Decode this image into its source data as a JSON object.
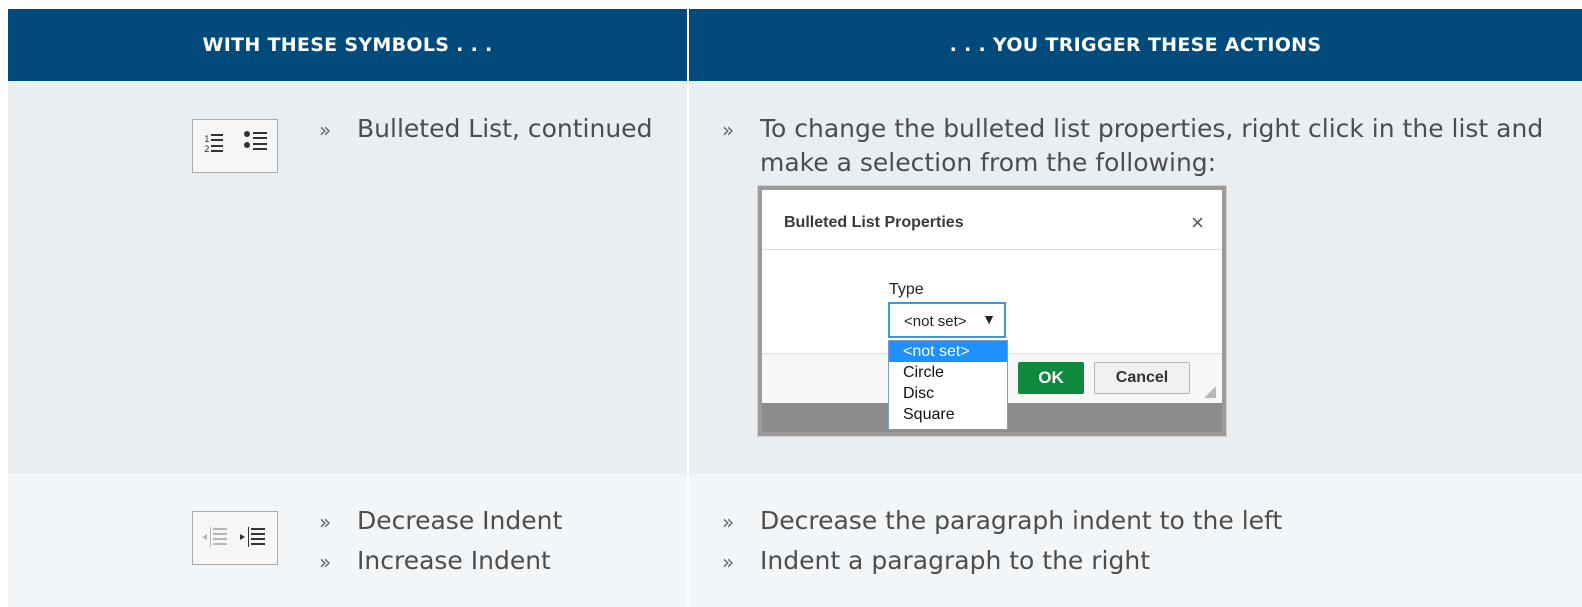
{
  "header": {
    "left": "WITH THESE SYMBOLS . . .",
    "right": ". . . YOU TRIGGER THESE ACTIONS"
  },
  "rows": [
    {
      "icons": [
        "numbered-list-icon",
        "bulleted-list-icon"
      ],
      "symbols": [
        "Bulleted List, continued"
      ],
      "actions": [
        "To change the bulleted list properties, right click in the list and",
        "make a selection from the following:"
      ]
    },
    {
      "icons": [
        "decrease-indent-icon",
        "increase-indent-icon"
      ],
      "symbols": [
        "Decrease Indent",
        "Increase Indent"
      ],
      "actions": [
        "Decrease the paragraph indent to the left",
        "Indent a paragraph to the right"
      ]
    }
  ],
  "bullet": "»",
  "dialog": {
    "title": "Bulleted List Properties",
    "close": "×",
    "type_label": "Type",
    "selected": "<not set>",
    "arrow": "▼",
    "options": [
      "<not set>",
      "Circle",
      "Disc",
      "Square"
    ],
    "ok": "OK",
    "cancel": "Cancel"
  }
}
